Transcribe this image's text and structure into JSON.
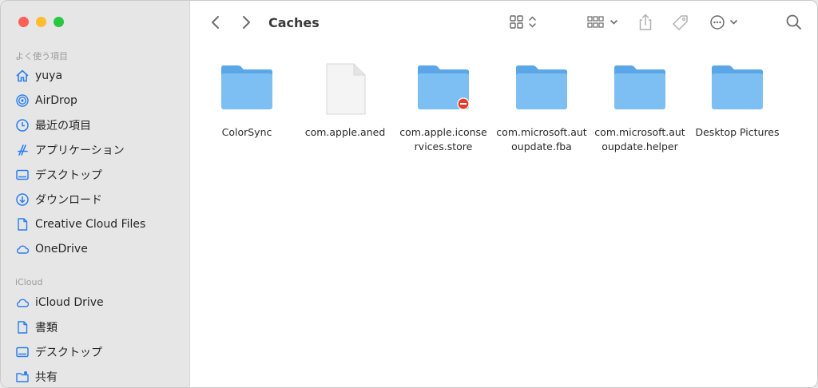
{
  "window": {
    "title": "Caches"
  },
  "sidebar": {
    "section_favorites": "よく使う項目",
    "favorites": [
      {
        "label": "yuya",
        "icon": "home-icon"
      },
      {
        "label": "AirDrop",
        "icon": "airdrop-icon"
      },
      {
        "label": "最近の項目",
        "icon": "clock-icon"
      },
      {
        "label": "アプリケーション",
        "icon": "applications-icon"
      },
      {
        "label": "デスクトップ",
        "icon": "desktop-icon"
      },
      {
        "label": "ダウンロード",
        "icon": "download-icon"
      },
      {
        "label": "Creative Cloud Files",
        "icon": "document-icon"
      },
      {
        "label": "OneDrive",
        "icon": "cloud-icon"
      }
    ],
    "section_icloud": "iCloud",
    "icloud": [
      {
        "label": "iCloud Drive",
        "icon": "cloud-icon"
      },
      {
        "label": "書類",
        "icon": "document-icon"
      },
      {
        "label": "デスクトップ",
        "icon": "desktop-icon"
      },
      {
        "label": "共有",
        "icon": "shared-folder-icon"
      }
    ]
  },
  "files": [
    {
      "name": "ColorSync",
      "type": "folder"
    },
    {
      "name": "com.apple.aned",
      "type": "file"
    },
    {
      "name": "com.apple.iconse\nrvices.store",
      "type": "folder-restricted"
    },
    {
      "name": "com.microsoft.aut\noupdate.fba",
      "type": "folder"
    },
    {
      "name": "com.microsoft.aut\noupdate.helper",
      "type": "folder"
    },
    {
      "name": "Desktop Pictures",
      "type": "folder"
    }
  ],
  "colors": {
    "folder": "#7dbff2",
    "folder_tab": "#5aa6e6",
    "accent": "#2a7ef0",
    "restricted": "#e23d2d"
  }
}
